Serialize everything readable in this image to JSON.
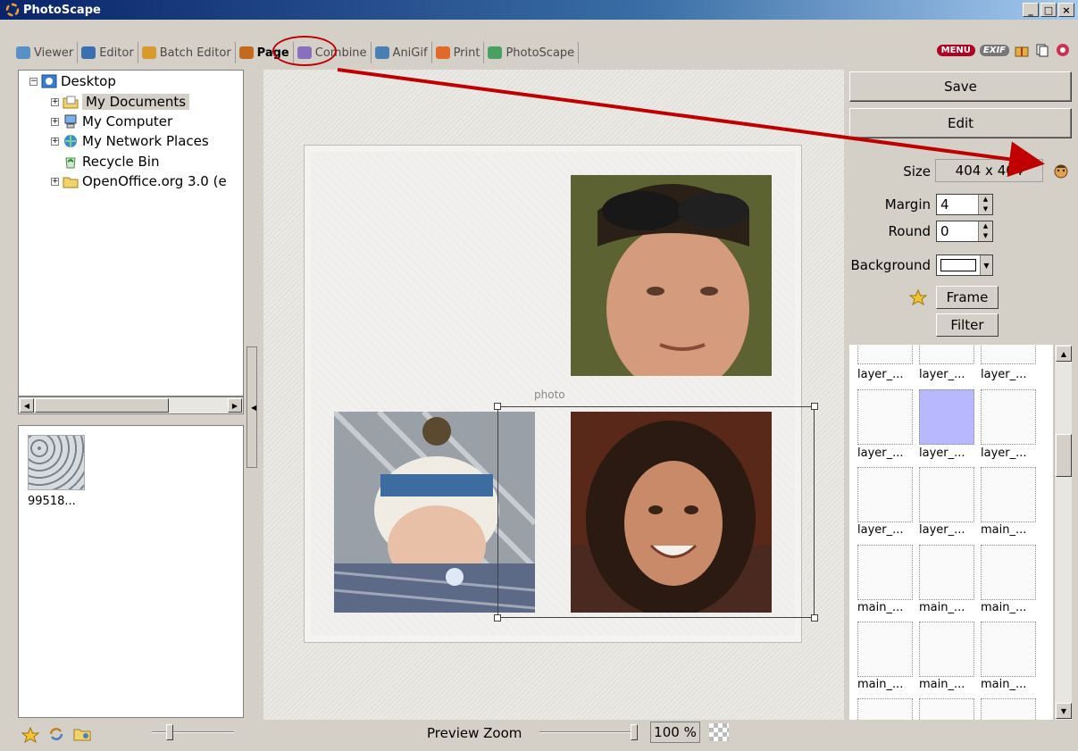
{
  "window": {
    "title": "PhotoScape",
    "minimize": "_",
    "maximize": "□",
    "close": "×"
  },
  "tabs": [
    {
      "label": "Viewer",
      "color": "#4a7fb5"
    },
    {
      "label": "Editor",
      "color": "#3b6fb0"
    },
    {
      "label": "Batch Editor",
      "color": "#d89a2a"
    },
    {
      "label": "Page",
      "color": "#c46a1e"
    },
    {
      "label": "Combine",
      "color": "#8a6fc0"
    },
    {
      "label": "AniGif",
      "color": "#4a7fb5"
    },
    {
      "label": "Print",
      "color": "#e06a2a"
    },
    {
      "label": "PhotoScape",
      "color": "#4aa060"
    }
  ],
  "toolbar_right": {
    "menu": "MENU",
    "exif": "EXIF"
  },
  "tree": {
    "items": [
      {
        "label": "Desktop",
        "expander": "−"
      },
      {
        "label": "My Documents",
        "expander": "+"
      },
      {
        "label": "My Computer",
        "expander": "+"
      },
      {
        "label": "My Network Places",
        "expander": "+"
      },
      {
        "label": "Recycle Bin",
        "expander": ""
      },
      {
        "label": "OpenOffice.org 3.0 (e",
        "expander": "+"
      }
    ]
  },
  "thumbnails": [
    {
      "label": "99518..."
    }
  ],
  "canvas": {
    "photo_label": "photo"
  },
  "right_panel": {
    "save": "Save",
    "edit": "Edit",
    "size_label": "Size",
    "size_value": "404 x 404",
    "margin_label": "Margin",
    "margin_value": "4",
    "round_label": "Round",
    "round_value": "0",
    "background_label": "Background",
    "frame": "Frame",
    "filter": "Filter"
  },
  "templates": {
    "labels": [
      "layer_...",
      "layer_...",
      "layer_...",
      "layer_...",
      "layer_...",
      "layer_...",
      "layer_...",
      "layer_...",
      "main_...",
      "main_...",
      "main_...",
      "main_...",
      "main_...",
      "main_...",
      "main_..."
    ]
  },
  "bottom": {
    "zoom_label": "Preview Zoom",
    "zoom_value": "100 %"
  }
}
